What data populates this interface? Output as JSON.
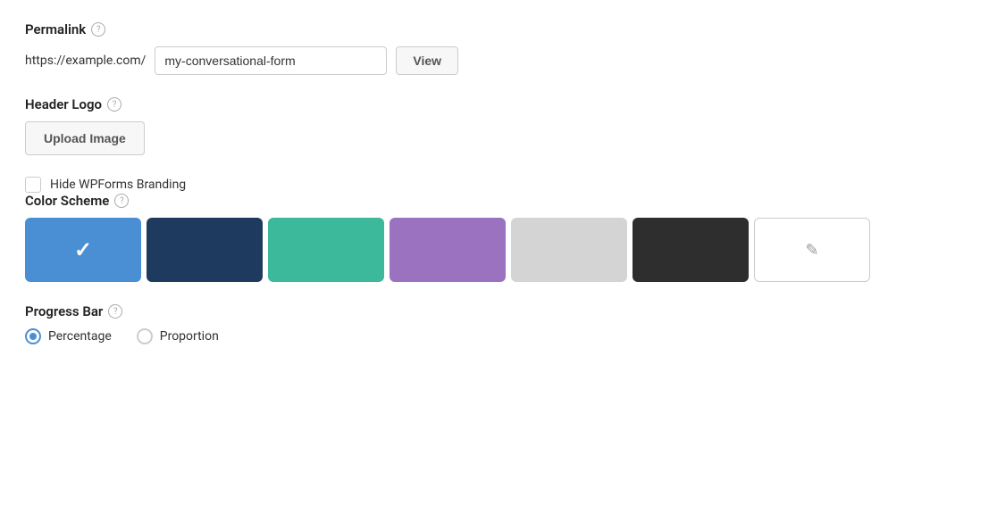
{
  "permalink": {
    "label": "Permalink",
    "base_url": "https://example.com/",
    "slug_value": "my-conversational-form",
    "view_button_label": "View"
  },
  "header_logo": {
    "label": "Header Logo",
    "upload_button_label": "Upload Image"
  },
  "hide_branding": {
    "label": "Hide WPForms Branding",
    "checked": false
  },
  "color_scheme": {
    "label": "Color Scheme",
    "swatches": [
      {
        "id": "blue",
        "color": "#4a8fd4",
        "selected": true
      },
      {
        "id": "navy",
        "color": "#1e3a5f",
        "selected": false
      },
      {
        "id": "teal",
        "color": "#3cb89a",
        "selected": false
      },
      {
        "id": "purple",
        "color": "#9b72c0",
        "selected": false
      },
      {
        "id": "light-gray",
        "color": "#d4d4d4",
        "selected": false
      },
      {
        "id": "dark",
        "color": "#2e2e2e",
        "selected": false
      },
      {
        "id": "custom",
        "color": "custom",
        "selected": false
      }
    ]
  },
  "progress_bar": {
    "label": "Progress Bar",
    "options": [
      {
        "id": "percentage",
        "label": "Percentage",
        "checked": true
      },
      {
        "id": "proportion",
        "label": "Proportion",
        "checked": false
      }
    ]
  },
  "icons": {
    "help": "?",
    "pen": "✎",
    "check": "✓"
  }
}
